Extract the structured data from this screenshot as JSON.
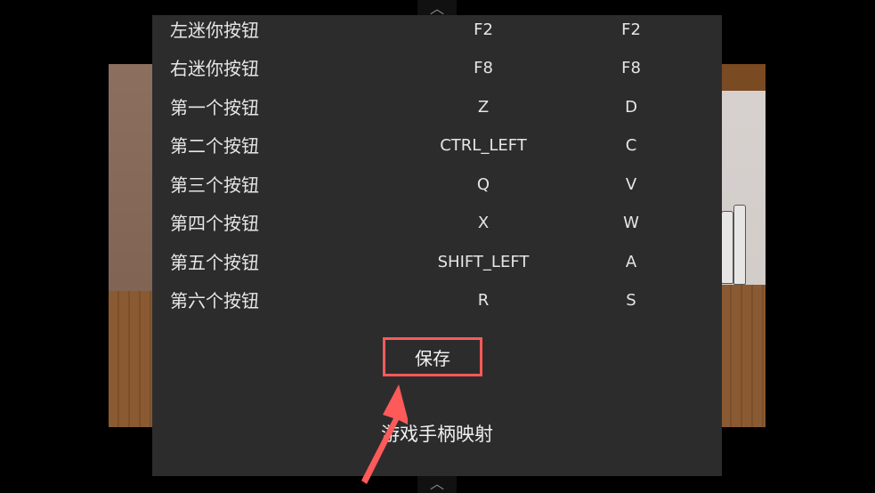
{
  "dialog": {
    "title": "游戏手柄映射",
    "save_label": "保存",
    "rows": [
      {
        "name": "左迷你按钮",
        "key1": "F2",
        "key2": "F2"
      },
      {
        "name": "右迷你按钮",
        "key1": "F8",
        "key2": "F8"
      },
      {
        "name": "第一个按钮",
        "key1": "Z",
        "key2": "D"
      },
      {
        "name": "第二个按钮",
        "key1": "CTRL_LEFT",
        "key2": "C"
      },
      {
        "name": "第三个按钮",
        "key1": "Q",
        "key2": "V"
      },
      {
        "name": "第四个按钮",
        "key1": "X",
        "key2": "W"
      },
      {
        "name": "第五个按钮",
        "key1": "SHIFT_LEFT",
        "key2": "A"
      },
      {
        "name": "第六个按钮",
        "key1": "R",
        "key2": "S"
      }
    ]
  },
  "icons": {
    "top_handle": "chevron-up-icon",
    "bottom_handle": "chevron-up-icon",
    "annotation": "red-arrow-icon"
  },
  "colors": {
    "dialog_bg": "#2c2c2d",
    "highlight": "#ff5a5a",
    "text": "#e6e6e6"
  }
}
